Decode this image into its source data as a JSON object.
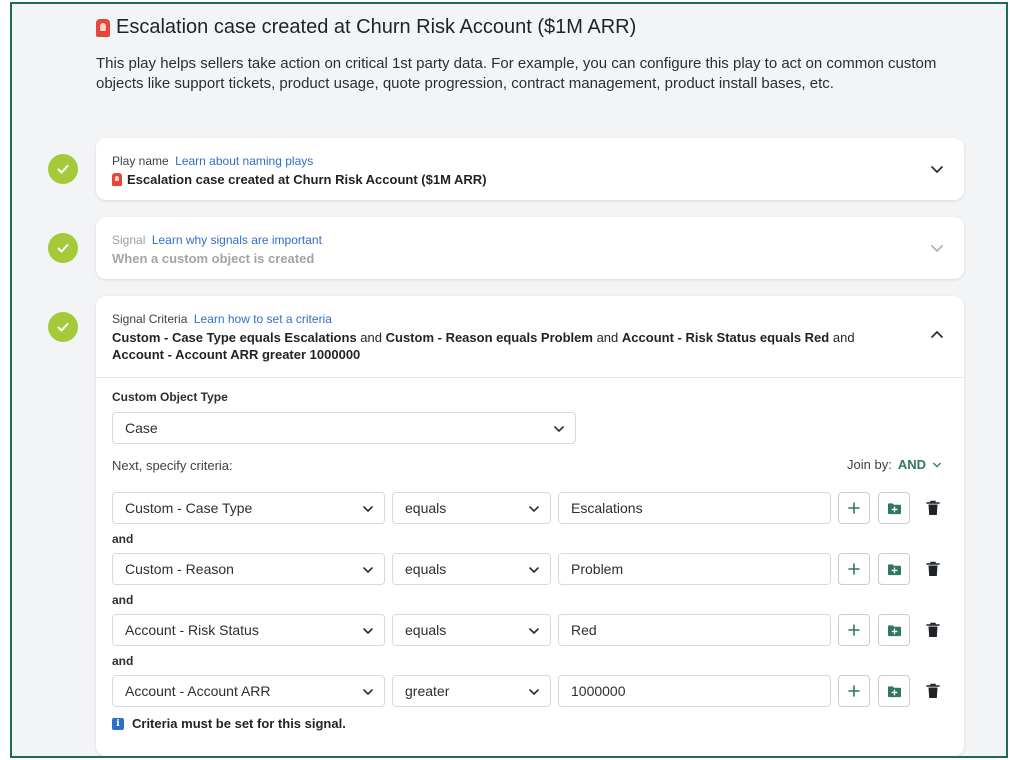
{
  "header": {
    "title": "Escalation case created at Churn Risk Account ($1M ARR)",
    "description": "This play helps sellers take action on critical 1st party data. For example, you can configure this play to act on common custom objects like support tickets, product usage, quote progression, contract management, product install bases, etc."
  },
  "play_name": {
    "label": "Play name",
    "link": "Learn about naming plays",
    "value": "Escalation case created at Churn Risk Account ($1M ARR)"
  },
  "signal": {
    "label": "Signal",
    "link": "Learn why signals are important",
    "value": "When a custom object is created"
  },
  "signal_criteria": {
    "label": "Signal Criteria",
    "link": "Learn how to set a criteria",
    "summary": {
      "p1": "Custom - Case Type equals Escalations",
      "c1": "and",
      "p2": "Custom - Reason equals Problem",
      "c2": "and",
      "p3": "Account - Risk Status equals Red",
      "c3": "and",
      "p4": "Account - Account ARR greater 1000000"
    },
    "object_type_label": "Custom Object Type",
    "object_type_value": "Case",
    "next_label": "Next, specify criteria:",
    "join_by_label": "Join by:",
    "join_by_value": "AND",
    "rows": [
      {
        "field": "Custom - Case Type",
        "operator": "equals",
        "value": "Escalations"
      },
      {
        "field": "Custom - Reason",
        "operator": "equals",
        "value": "Problem"
      },
      {
        "field": "Account - Risk Status",
        "operator": "equals",
        "value": "Red"
      },
      {
        "field": "Account - Account ARR",
        "operator": "greater",
        "value": "1000000"
      }
    ],
    "and_label": "and",
    "note": "Criteria must be set for this signal."
  },
  "colors": {
    "check": "#a6c93a",
    "link": "#2f6fc9",
    "join": "#2f7a5a",
    "frame": "#1f6b57"
  }
}
